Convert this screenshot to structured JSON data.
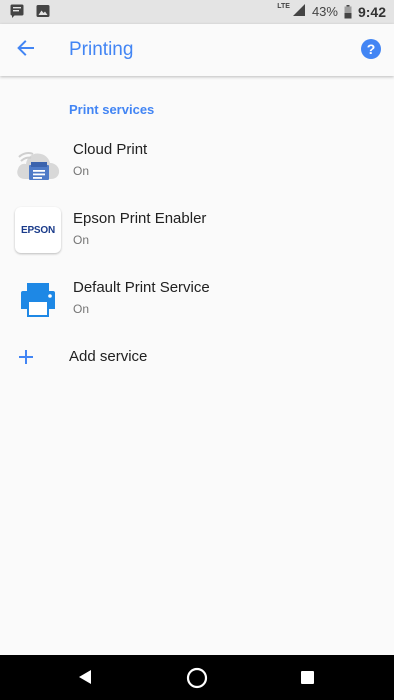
{
  "status_bar": {
    "network": "LTE",
    "battery": "43%",
    "time": "9:42"
  },
  "app_bar": {
    "title": "Printing",
    "back_icon": "arrow-back-icon",
    "help_icon": "help-icon"
  },
  "section": {
    "header": "Print services"
  },
  "services": [
    {
      "title": "Cloud Print",
      "status": "On",
      "icon": "cloud-print-icon"
    },
    {
      "title": "Epson Print Enabler",
      "status": "On",
      "icon": "epson-logo",
      "logo_text": "EPSON"
    },
    {
      "title": "Default Print Service",
      "status": "On",
      "icon": "printer-icon"
    }
  ],
  "add_service": {
    "label": "Add service",
    "icon": "plus-icon"
  },
  "colors": {
    "accent": "#4285f4",
    "primary_text": "#212121",
    "secondary_text": "#757575"
  }
}
